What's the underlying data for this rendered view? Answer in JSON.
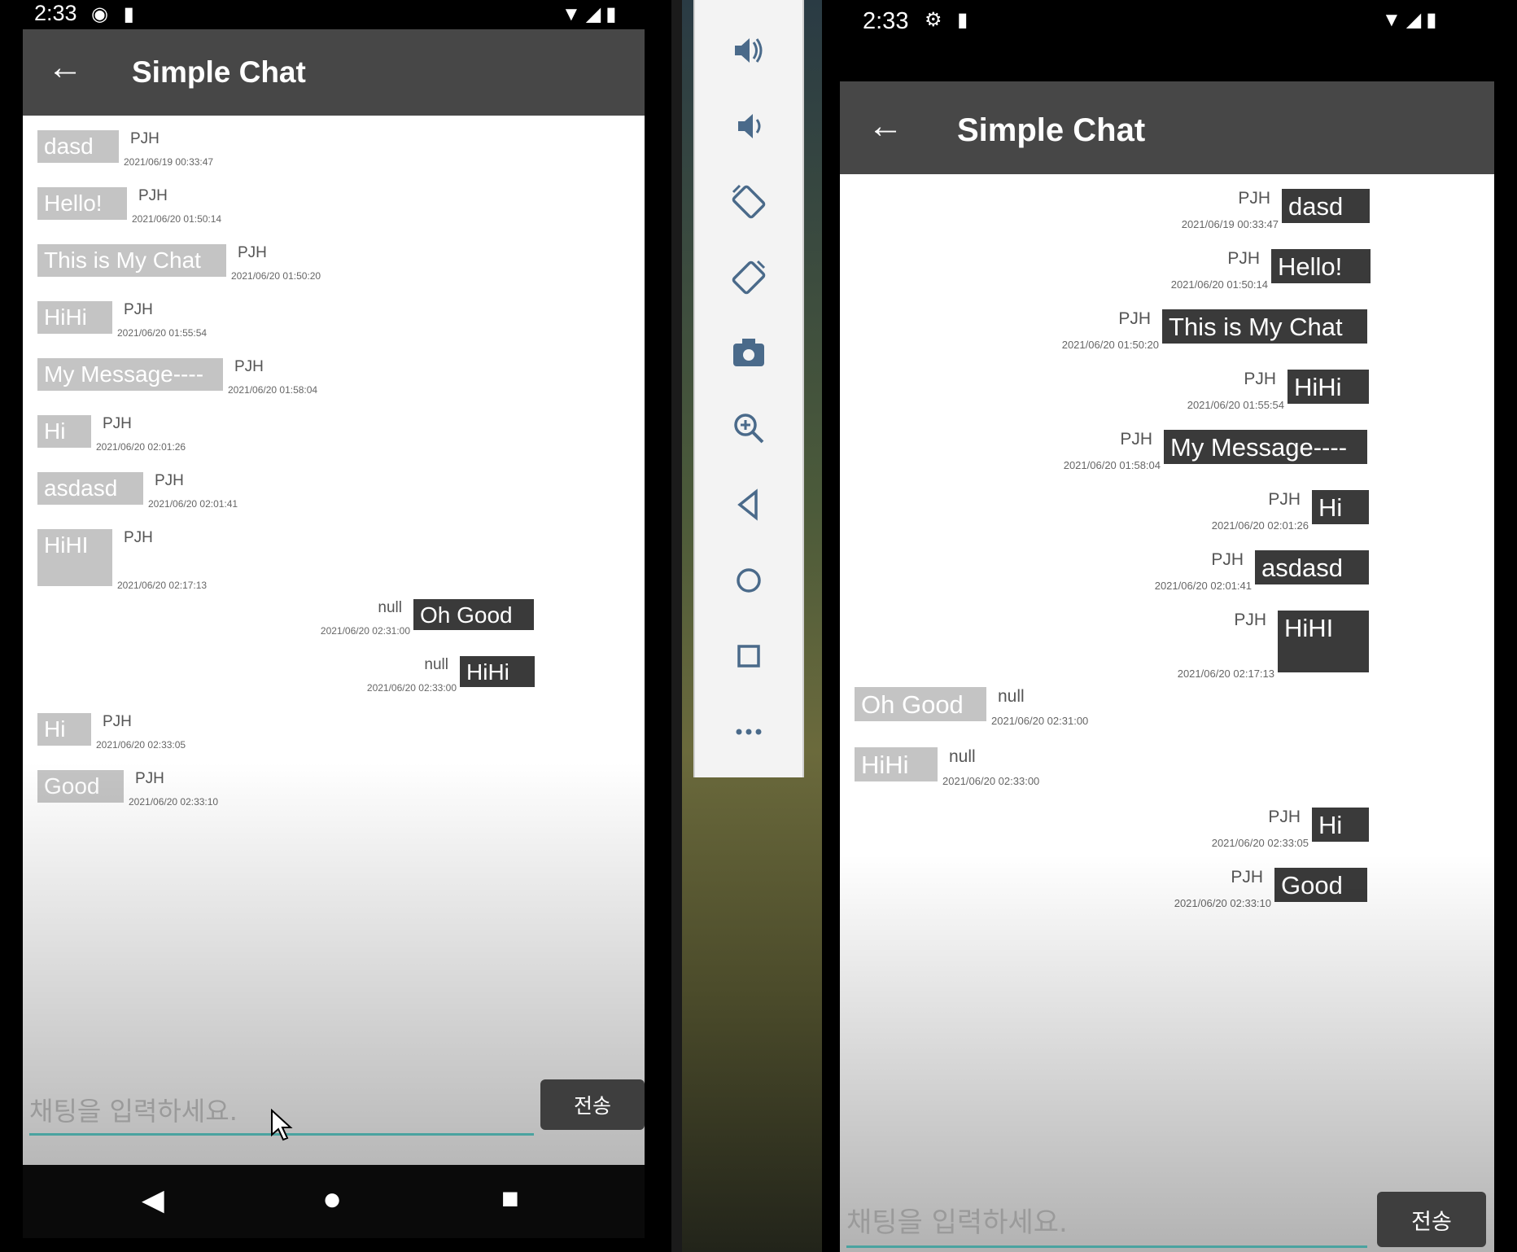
{
  "app": {
    "title": "Simple Chat"
  },
  "status_bar": {
    "time": "2:33"
  },
  "input": {
    "placeholder": "채팅을 입력하세요.",
    "send_label": "전송"
  },
  "messages_left": [
    {
      "text": "dasd",
      "sender": "PJH",
      "time": "2021/06/19 00:33:47"
    },
    {
      "text": "Hello!",
      "sender": "PJH",
      "time": "2021/06/20 01:50:14"
    },
    {
      "text": "This is My Chat",
      "sender": "PJH",
      "time": "2021/06/20 01:50:20"
    },
    {
      "text": "HiHi",
      "sender": "PJH",
      "time": "2021/06/20 01:55:54"
    },
    {
      "text": "My Message----",
      "sender": "PJH",
      "time": "2021/06/20 01:58:04"
    },
    {
      "text": "Hi",
      "sender": "PJH",
      "time": "2021/06/20 02:01:26"
    },
    {
      "text": "asdasd",
      "sender": "PJH",
      "time": "2021/06/20 02:01:41"
    },
    {
      "text": "HiHI",
      "sender": "PJH",
      "time": "2021/06/20 02:17:13"
    },
    {
      "text": "Oh Good",
      "sender": "null",
      "time": "2021/06/20 02:31:00"
    },
    {
      "text": "HiHi",
      "sender": "null",
      "time": "2021/06/20 02:33:00"
    },
    {
      "text": "Hi",
      "sender": "PJH",
      "time": "2021/06/20 02:33:05"
    },
    {
      "text": "Good",
      "sender": "PJH",
      "time": "2021/06/20 02:33:10"
    }
  ],
  "messages_right": [
    {
      "text": "dasd",
      "sender": "PJH",
      "time": "2021/06/19 00:33:47"
    },
    {
      "text": "Hello!",
      "sender": "PJH",
      "time": "2021/06/20 01:50:14"
    },
    {
      "text": "This is My Chat",
      "sender": "PJH",
      "time": "2021/06/20 01:50:20"
    },
    {
      "text": "HiHi",
      "sender": "PJH",
      "time": "2021/06/20 01:55:54"
    },
    {
      "text": "My Message----",
      "sender": "PJH",
      "time": "2021/06/20 01:58:04"
    },
    {
      "text": "Hi",
      "sender": "PJH",
      "time": "2021/06/20 02:01:26"
    },
    {
      "text": "asdasd",
      "sender": "PJH",
      "time": "2021/06/20 02:01:41"
    },
    {
      "text": "HiHI",
      "sender": "PJH",
      "time": "2021/06/20 02:17:13"
    },
    {
      "text": "Oh Good",
      "sender": "null",
      "time": "2021/06/20 02:31:00"
    },
    {
      "text": "HiHi",
      "sender": "null",
      "time": "2021/06/20 02:33:00"
    },
    {
      "text": "Hi",
      "sender": "PJH",
      "time": "2021/06/20 02:33:05"
    },
    {
      "text": "Good",
      "sender": "PJH",
      "time": "2021/06/20 02:33:10"
    }
  ],
  "toolbar_icons": [
    "volume-up-icon",
    "volume-down-icon",
    "rotate-left-icon",
    "rotate-right-icon",
    "camera-icon",
    "zoom-icon",
    "back-icon",
    "home-icon",
    "overview-icon",
    "more-icon"
  ],
  "colors": {
    "app_bar": "#474747",
    "own_bubble": "#3a3a3a",
    "other_bubble": "#c4c4c4",
    "input_underline": "#4aa3a0",
    "send_button": "#3e3e3e"
  }
}
